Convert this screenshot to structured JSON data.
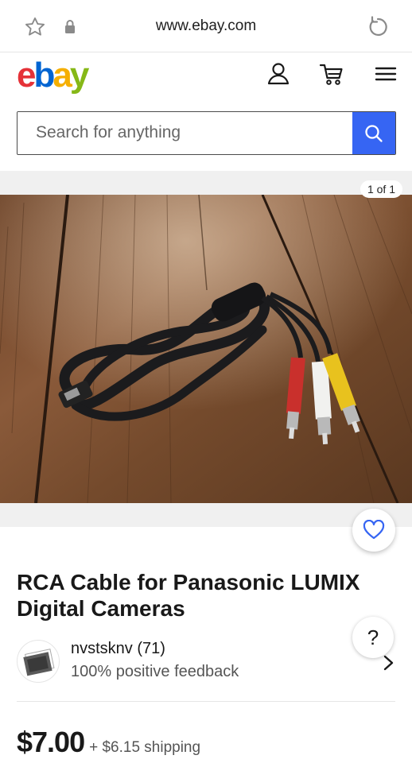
{
  "browser": {
    "url": "www.ebay.com"
  },
  "header": {
    "logo": {
      "e": "e",
      "b": "b",
      "a": "a",
      "y": "y"
    }
  },
  "search": {
    "placeholder": "Search for anything"
  },
  "gallery": {
    "counter": "1 of 1"
  },
  "listing": {
    "title": "RCA Cable for Panasonic LUMIX Digital Cameras",
    "seller_name": "nvstsknv (71)",
    "seller_feedback": "100% positive feedback",
    "price": "$7.00",
    "shipping": "+ $6.15 shipping"
  },
  "help": {
    "label": "?"
  },
  "colors": {
    "search_button": "#3665f3",
    "logo_e": "#e53238",
    "logo_b": "#0064d2",
    "logo_a": "#f5af02",
    "logo_y": "#86b817"
  }
}
